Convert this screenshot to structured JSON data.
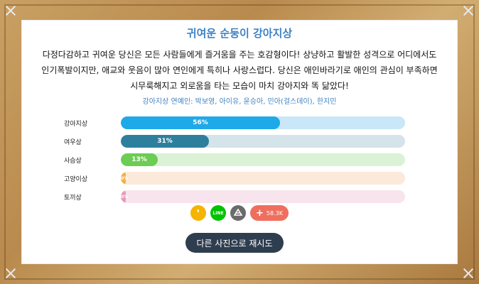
{
  "title": "귀여운 순둥이 강아지상",
  "description_lines": [
    "다정다감하고 귀여운 당신은 모든 사람들에게 즐거움을 주는 호감형이다! 상냥하고 활발한 성격으로 어디에서도",
    "인기폭발이지만, 애교와 웃음이 많아 연인에게 특히나 사랑스럽다. 당신은 애인바라기로 애인의 관심이 부족하면",
    "시무룩해지고 외로움을 타는 모습이 마치 강아지와 똑 닮았다!"
  ],
  "celebs": "강아지상 연예인: 박보영, 아이유, 윤승아, 민아(걸스데이), 한지민",
  "results": [
    {
      "label": "강아지상",
      "percent": 56,
      "percent_text": "56%",
      "fill_color": "#1ea9e8",
      "track_color": "#c9e7f8"
    },
    {
      "label": "여우상",
      "percent": 31,
      "percent_text": "31%",
      "fill_color": "#2e7f9e",
      "track_color": "#d5e3ea"
    },
    {
      "label": "사슴상",
      "percent": 13,
      "percent_text": "13%",
      "fill_color": "#6ccc53",
      "track_color": "#dcf2d6"
    },
    {
      "label": "고양이상",
      "percent": 0,
      "percent_text": "0%",
      "fill_color": "#f4b144",
      "track_color": "#fbe9d9"
    },
    {
      "label": "토끼상",
      "percent": 0,
      "percent_text": "0%",
      "fill_color": "#e79ab8",
      "track_color": "#f8e4ec"
    }
  ],
  "share": {
    "kakaostory_icon": "kakaostory-icon",
    "line_icon": "line-icon",
    "band_icon": "band-icon",
    "more_icon": "plus-icon",
    "line_text": "LINE",
    "count": "58.3K"
  },
  "retry_label": "다른 사진으로 재시도",
  "colors": {
    "title": "#3d82c4",
    "kakaostory": "#f4b400",
    "line": "#00c300",
    "band": "#6b6b6b",
    "more": "#ef6f5e",
    "retry_bg": "#2f3e4f"
  }
}
